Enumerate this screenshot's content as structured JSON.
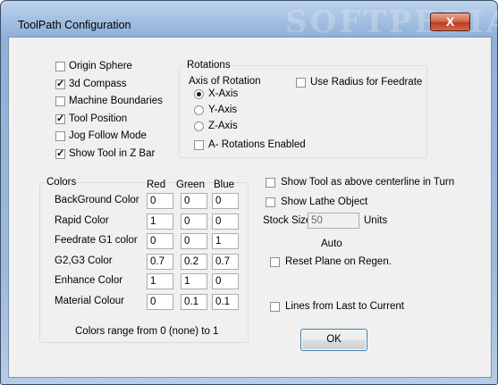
{
  "window": {
    "title": "ToolPath Configuration",
    "watermark": "SOFTPEDIA",
    "close_label": "X"
  },
  "display_options": [
    {
      "label": "Origin Sphere",
      "checked": false
    },
    {
      "label": "3d Compass",
      "checked": true
    },
    {
      "label": "Machine Boundaries",
      "checked": false
    },
    {
      "label": "Tool Position",
      "checked": true
    },
    {
      "label": "Jog Follow Mode",
      "checked": false
    },
    {
      "label": "Show Tool in Z Bar",
      "checked": true
    }
  ],
  "rotations": {
    "group_label": "Rotations",
    "axis_label": "Axis of Rotation",
    "axes": [
      {
        "label": "X-Axis",
        "selected": true
      },
      {
        "label": "Y-Axis",
        "selected": false
      },
      {
        "label": "Z-Axis",
        "selected": false
      }
    ],
    "a_rotations_label": "A- Rotations Enabled",
    "a_rotations_checked": false,
    "use_radius_label": "Use Radius for Feedrate",
    "use_radius_checked": false
  },
  "colors": {
    "group_label": "Colors",
    "headers": [
      "Red",
      "Green",
      "Blue"
    ],
    "rows": [
      {
        "label": "BackGround Color",
        "values": [
          "0",
          "0",
          "0"
        ]
      },
      {
        "label": "Rapid Color",
        "values": [
          "1",
          "0",
          "0"
        ]
      },
      {
        "label": "Feedrate G1 color",
        "values": [
          "0",
          "0",
          "1"
        ]
      },
      {
        "label": "G2,G3 Color",
        "values": [
          "0.7",
          "0.2",
          "0.7"
        ]
      },
      {
        "label": "Enhance Color",
        "values": [
          "1",
          "1",
          "0"
        ]
      },
      {
        "label": "Material Colour",
        "values": [
          "0",
          "0.1",
          "0.1"
        ]
      }
    ],
    "range_note": "Colors range from 0 (none) to 1"
  },
  "lathe": {
    "show_tool_above_label": "Show Tool as above centerline in Turn",
    "show_tool_above_checked": false,
    "show_lathe_label": "Show Lathe Object",
    "show_lathe_checked": false,
    "stock_size_label": "Stock Size",
    "stock_size_value": "50",
    "units_label": "Units",
    "auto_label": "Auto",
    "reset_plane_label": "Reset Plane on Regen.",
    "reset_plane_checked": false,
    "lines_label": "Lines from Last to Current",
    "lines_checked": false
  },
  "ok_label": "OK"
}
